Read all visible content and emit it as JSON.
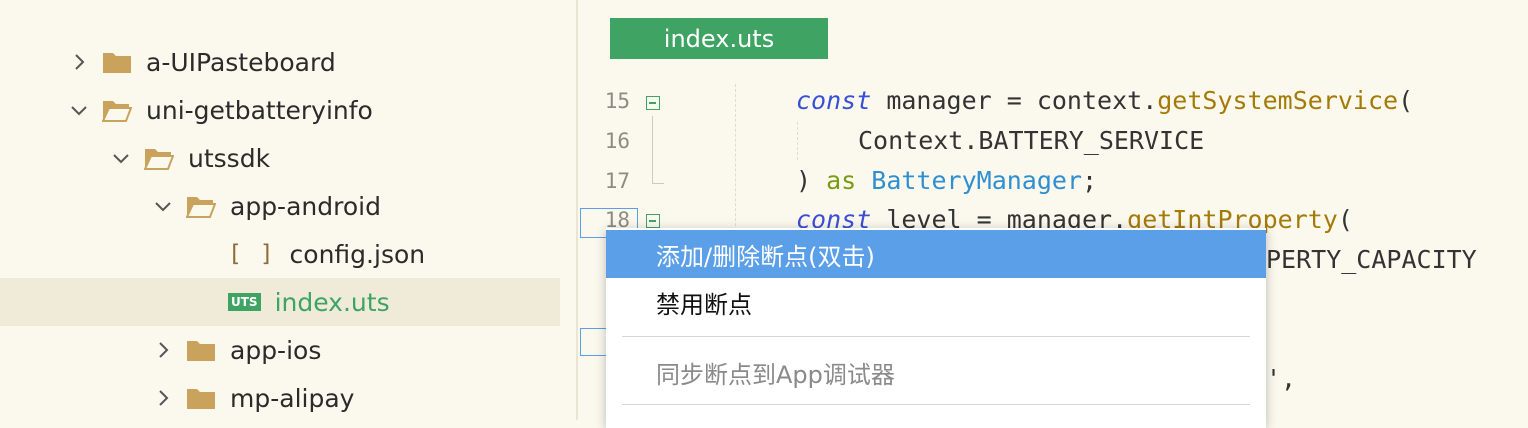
{
  "sidebar": {
    "items": [
      {
        "label": "a-UIPasteboard",
        "expanded": false,
        "type": "folder"
      },
      {
        "label": "uni-getbatteryinfo",
        "expanded": true,
        "type": "folder"
      },
      {
        "label": "utssdk",
        "expanded": true,
        "type": "folder"
      },
      {
        "label": "app-android",
        "expanded": true,
        "type": "folder"
      },
      {
        "label": "config.json",
        "type": "json-file",
        "icon": "[ ]"
      },
      {
        "label": "index.uts",
        "type": "uts-file",
        "icon": "UTS",
        "selected": true
      },
      {
        "label": "app-ios",
        "expanded": false,
        "type": "folder"
      },
      {
        "label": "mp-alipay",
        "expanded": false,
        "type": "folder"
      }
    ]
  },
  "editor": {
    "tab_label": "index.uts",
    "lines": [
      {
        "no": "15"
      },
      {
        "no": "16"
      },
      {
        "no": "17"
      },
      {
        "no": "18"
      }
    ],
    "code": {
      "l15_kw": "const",
      "l15_a": " manager = context.",
      "l15_fn": "getSystemService",
      "l15_b": "(",
      "l16": "Context.BATTERY_SERVICE",
      "l17_a": ") ",
      "l17_kw": "as",
      "l17_ty": "BatteryManager",
      "l17_b": ";",
      "l18_kw": "const",
      "l18_a": " level = manager.",
      "l18_fn": "getIntProperty",
      "l18_b": "(",
      "l19": "PERTY_CAPACITY",
      "l22": "',"
    }
  },
  "context_menu": {
    "items": [
      {
        "label": "添加/删除断点(双击)",
        "state": "highlighted"
      },
      {
        "label": "禁用断点",
        "state": "normal"
      },
      {
        "label": "同步断点到App调试器",
        "state": "disabled"
      }
    ]
  },
  "colors": {
    "accent": "#3fa463",
    "menu_highlight": "#5a9fe8",
    "background": "#fbf9ee",
    "selected_row": "#efebd8",
    "folder": "#c9a35c"
  }
}
